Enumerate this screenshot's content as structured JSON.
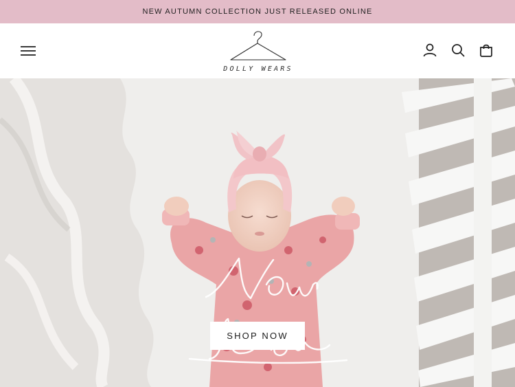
{
  "announcement": {
    "text": "NEW AUTUMN COLLECTION JUST RELEASED ONLINE"
  },
  "header": {
    "logo_text": "DOLLY WEARS",
    "icons": [
      "menu-icon",
      "account-icon",
      "search-icon",
      "cart-icon"
    ]
  },
  "hero": {
    "script_text": "Now Love",
    "cta_label": "SHOP NOW"
  },
  "colors": {
    "announcement_bg": "#e3bcc8",
    "pajama_pink": "#e9a3a4",
    "bow_pink": "#f1c6c9"
  }
}
